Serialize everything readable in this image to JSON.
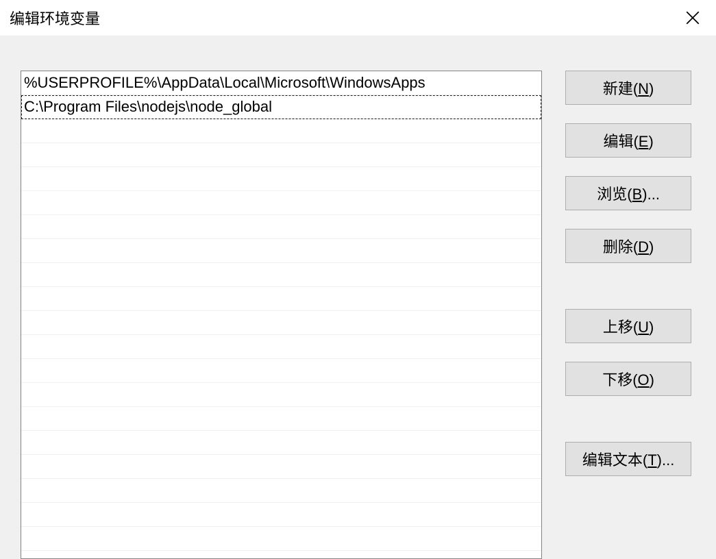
{
  "title": "编辑环境变量",
  "path_entries": [
    "%USERPROFILE%\\AppData\\Local\\Microsoft\\WindowsApps",
    "C:\\Program Files\\nodejs\\node_global"
  ],
  "selected_index": 1,
  "visible_row_count": 20,
  "buttons": {
    "new": {
      "prefix": "新建(",
      "accel": "N",
      "suffix": ")"
    },
    "edit": {
      "prefix": "编辑(",
      "accel": "E",
      "suffix": ")"
    },
    "browse": {
      "prefix": "浏览(",
      "accel": "B",
      "suffix": ")..."
    },
    "delete": {
      "prefix": "删除(",
      "accel": "D",
      "suffix": ")"
    },
    "moveup": {
      "prefix": "上移(",
      "accel": "U",
      "suffix": ")"
    },
    "movedown": {
      "prefix": "下移(",
      "accel": "O",
      "suffix": ")"
    },
    "edittext": {
      "prefix": "编辑文本(",
      "accel": "T",
      "suffix": ")..."
    }
  }
}
